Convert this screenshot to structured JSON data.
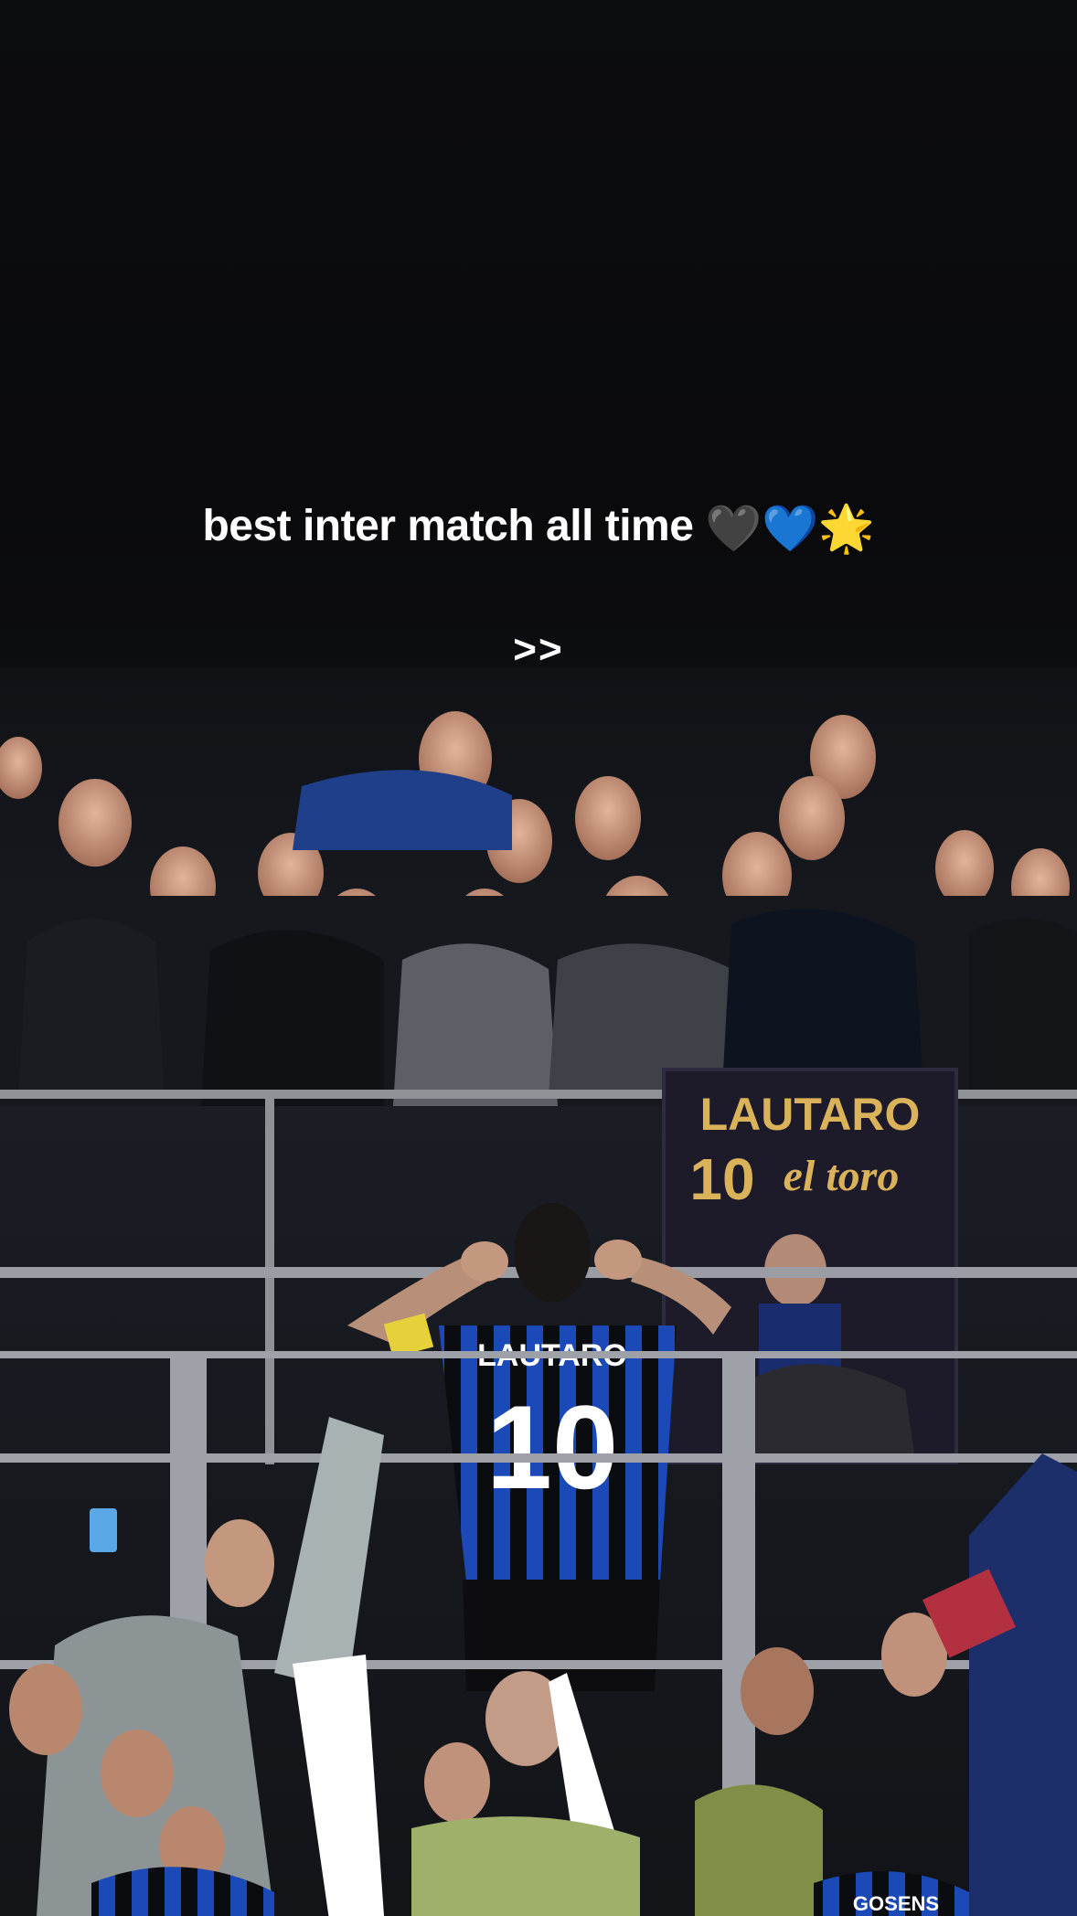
{
  "caption": {
    "text": "best inter match all time",
    "emojis": "🖤💙🌟"
  },
  "next_indicator": ">>",
  "photo": {
    "banner_line1": "LAUTARO",
    "banner_line2_number": "10",
    "banner_line2_text": "el toro",
    "jersey_name": "LAUTARO",
    "jersey_number": "10",
    "bottom_jersey_name": "GOSENS"
  },
  "colors": {
    "background": "#0b0c0e",
    "inter_blue": "#1f4fbf",
    "banner_gold": "#d9b25a"
  }
}
